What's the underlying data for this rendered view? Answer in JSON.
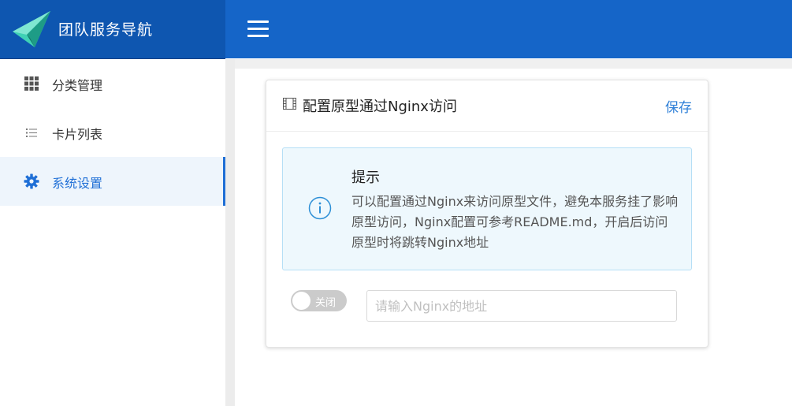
{
  "app": {
    "title": "团队服务导航"
  },
  "sidebar": {
    "items": [
      {
        "label": "分类管理",
        "icon": "grid-icon",
        "active": false
      },
      {
        "label": "卡片列表",
        "icon": "list-icon",
        "active": false
      },
      {
        "label": "系统设置",
        "icon": "gear-icon",
        "active": true
      }
    ]
  },
  "card": {
    "title": "配置原型通过Nginx访问",
    "save_label": "保存",
    "alert": {
      "title": "提示",
      "body": "可以配置通过Nginx来访问原型文件，避免本服务挂了影响原型访问，Nginx配置可参考README.md，开启后访问原型时将跳转Nginx地址"
    },
    "toggle": {
      "label": "关闭",
      "on": false
    },
    "nginx_input": {
      "value": "",
      "placeholder": "请输入Nginx的地址"
    }
  },
  "colors": {
    "logo_bar": "#0e56b0",
    "topbar": "#1565c8",
    "accent": "#1f6fd6",
    "alert_bg": "#eef8fd",
    "alert_border": "#b6dff6"
  }
}
